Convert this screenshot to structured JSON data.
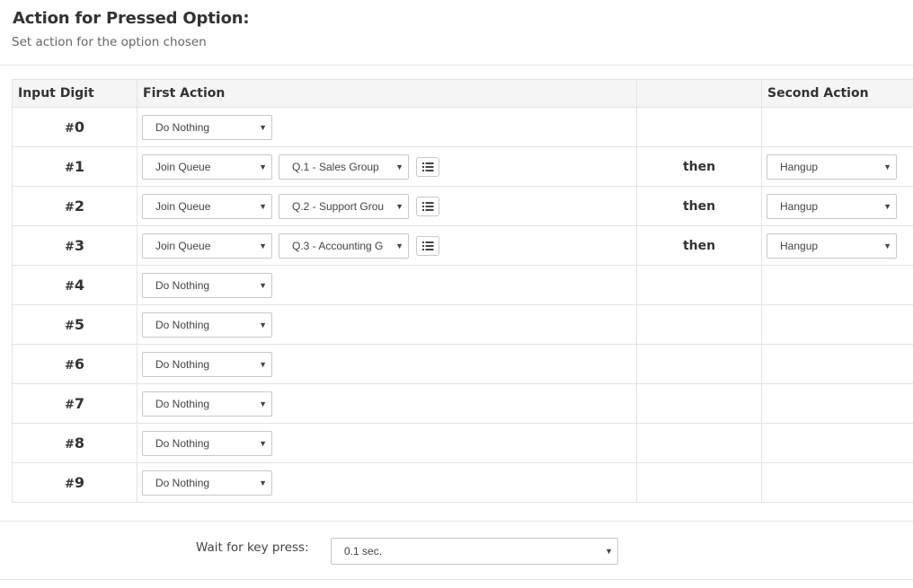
{
  "header": {
    "title": "Action for Pressed Option:",
    "subtitle": "Set action for the option chosen"
  },
  "table": {
    "columns": [
      "Input Digit",
      "First Action",
      "",
      "Second Action"
    ],
    "rows": [
      {
        "digit": "0",
        "action": "Do Nothing"
      },
      {
        "digit": "1",
        "action": "Join Queue",
        "queue": "Q.1 - Sales Group",
        "then": "then",
        "second": "Hangup"
      },
      {
        "digit": "2",
        "action": "Join Queue",
        "queue": "Q.2 - Support Grou",
        "then": "then",
        "second": "Hangup"
      },
      {
        "digit": "3",
        "action": "Join Queue",
        "queue": "Q.3 - Accounting G",
        "then": "then",
        "second": "Hangup"
      },
      {
        "digit": "4",
        "action": "Do Nothing"
      },
      {
        "digit": "5",
        "action": "Do Nothing"
      },
      {
        "digit": "6",
        "action": "Do Nothing"
      },
      {
        "digit": "7",
        "action": "Do Nothing"
      },
      {
        "digit": "8",
        "action": "Do Nothing"
      },
      {
        "digit": "9",
        "action": "Do Nothing"
      }
    ]
  },
  "wait": {
    "label": "Wait for key press:",
    "value": "0.1 sec."
  },
  "icons": {
    "caret": "caret-down-icon",
    "list": "list-icon"
  }
}
